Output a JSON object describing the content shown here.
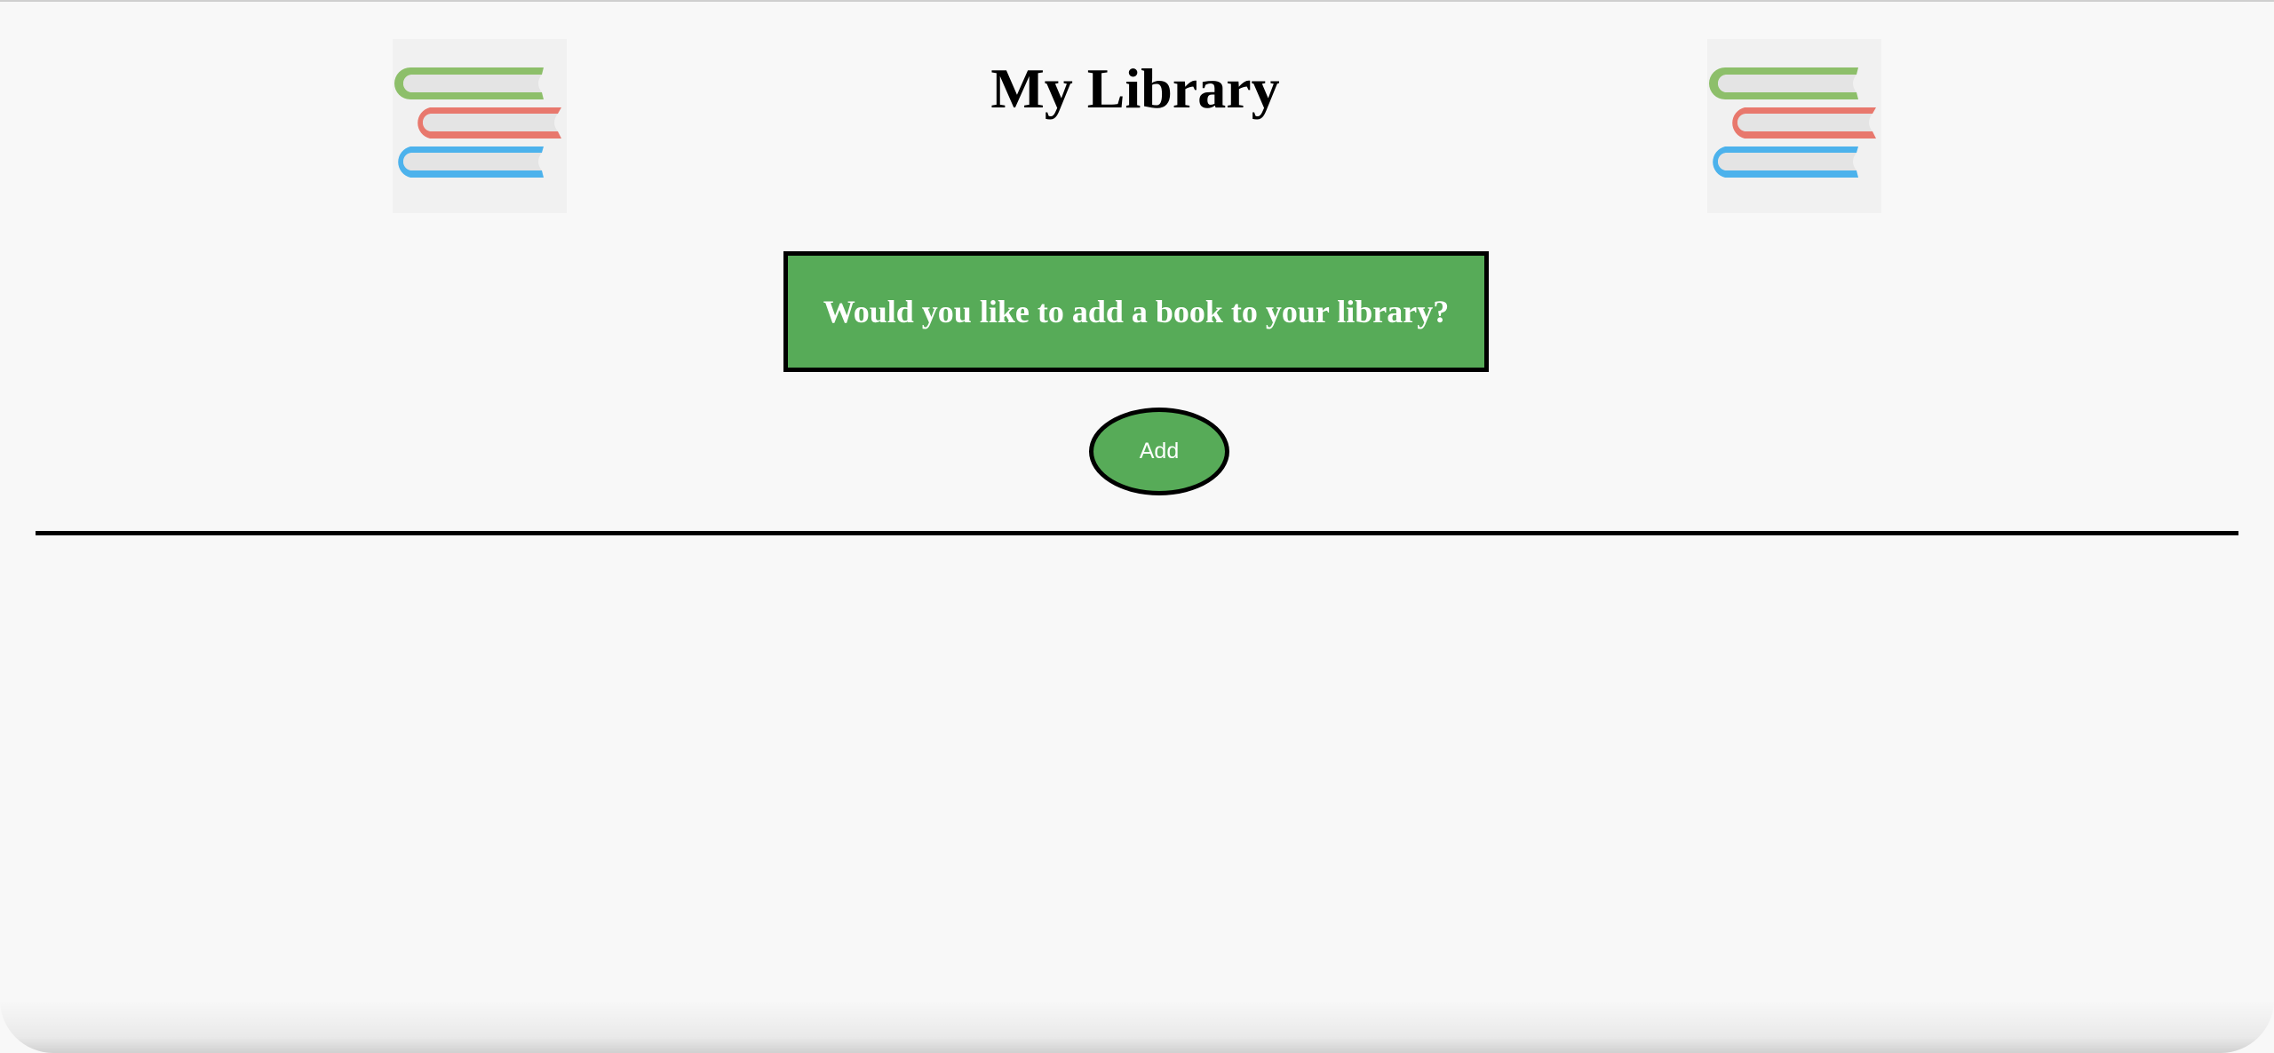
{
  "header": {
    "title": "My Library",
    "logo_left_icon": "stacked-books-icon",
    "logo_right_icon": "stacked-books-icon"
  },
  "prompt": {
    "text": "Would you like to add a book to your library?"
  },
  "actions": {
    "add_label": "Add"
  },
  "colors": {
    "background": "#f8f8f8",
    "accent_green": "#57ab58",
    "book_green": "#8dbf6a",
    "book_red": "#e8786d",
    "book_blue": "#4cb2ec",
    "page_gray": "#e4e4e4",
    "border": "#000000"
  }
}
